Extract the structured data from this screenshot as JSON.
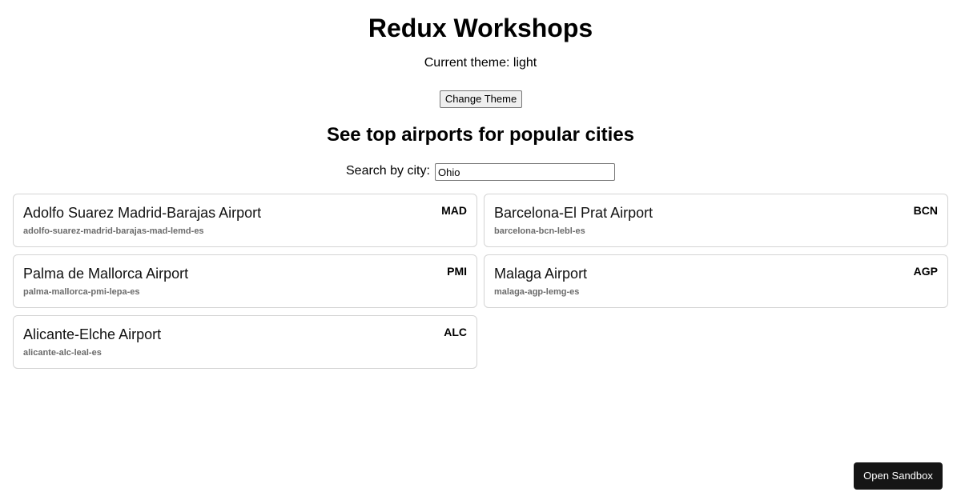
{
  "header": {
    "title": "Redux Workshops",
    "theme_prefix": "Current theme: ",
    "theme_value": "light",
    "change_theme_label": "Change Theme"
  },
  "airports_section": {
    "title": "See top airports for popular cities",
    "search_label": "Search by city:",
    "search_value": "Ohio"
  },
  "airports": [
    {
      "name": "Adolfo Suarez Madrid-Barajas Airport",
      "code": "MAD",
      "slug": "adolfo-suarez-madrid-barajas-mad-lemd-es"
    },
    {
      "name": "Barcelona-El Prat Airport",
      "code": "BCN",
      "slug": "barcelona-bcn-lebl-es"
    },
    {
      "name": "Palma de Mallorca Airport",
      "code": "PMI",
      "slug": "palma-mallorca-pmi-lepa-es"
    },
    {
      "name": "Malaga Airport",
      "code": "AGP",
      "slug": "malaga-agp-lemg-es"
    },
    {
      "name": "Alicante-Elche Airport",
      "code": "ALC",
      "slug": "alicante-alc-leal-es"
    }
  ],
  "footer": {
    "open_sandbox_label": "Open Sandbox"
  },
  "colors": {
    "sandbox_button_bg": "#151515",
    "card_border": "#d4d4d4",
    "slug_text": "#6b6b6b"
  }
}
